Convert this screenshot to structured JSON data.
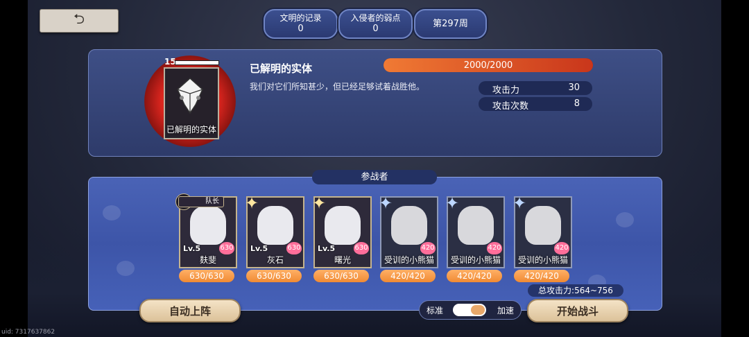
{
  "header": {
    "back_icon": "return-arrow-icon",
    "records": {
      "label": "文明的记录",
      "value": "0"
    },
    "weakness": {
      "label": "入侵者的弱点",
      "value": "0"
    },
    "week": "第297周"
  },
  "enemy": {
    "level": "15",
    "card_name": "已解明的实体",
    "title": "已解明的实体",
    "description": "我们对它们所知甚少，但已经足够试着战胜他。",
    "hp_text": "2000/2000",
    "hp_fraction": 1.0,
    "stats": [
      {
        "label": "攻击力",
        "value": "30"
      },
      {
        "label": "攻击次数",
        "value": "8"
      }
    ]
  },
  "participants": {
    "header": "参战者",
    "captain_label": "队长",
    "units": [
      {
        "lv": "Lv.5",
        "heart": "630",
        "name": "麸斐",
        "hp": "630/630",
        "kind": "hero"
      },
      {
        "lv": "Lv.5",
        "heart": "630",
        "name": "灰石",
        "hp": "630/630",
        "kind": "hero"
      },
      {
        "lv": "Lv.5",
        "heart": "630",
        "name": "曙光",
        "hp": "630/630",
        "kind": "hero"
      },
      {
        "lv": "",
        "heart": "420",
        "name": "受训的小熊猫",
        "hp": "420/420",
        "kind": "cat"
      },
      {
        "lv": "",
        "heart": "420",
        "name": "受训的小熊猫",
        "hp": "420/420",
        "kind": "cat"
      },
      {
        "lv": "",
        "heart": "420",
        "name": "受训的小熊猫",
        "hp": "420/420",
        "kind": "cat"
      }
    ],
    "total_power": "总攻击力:564~756"
  },
  "controls": {
    "auto_deploy": "自动上阵",
    "speed_normal": "标准",
    "speed_fast": "加速",
    "start_battle": "开始战斗"
  },
  "footer": {
    "uid": "uid: 7317637862"
  },
  "colors": {
    "hp_bar": "#e0562a",
    "accent_gold": "#e6cfa8",
    "panel_blue": "#4a63b6"
  }
}
